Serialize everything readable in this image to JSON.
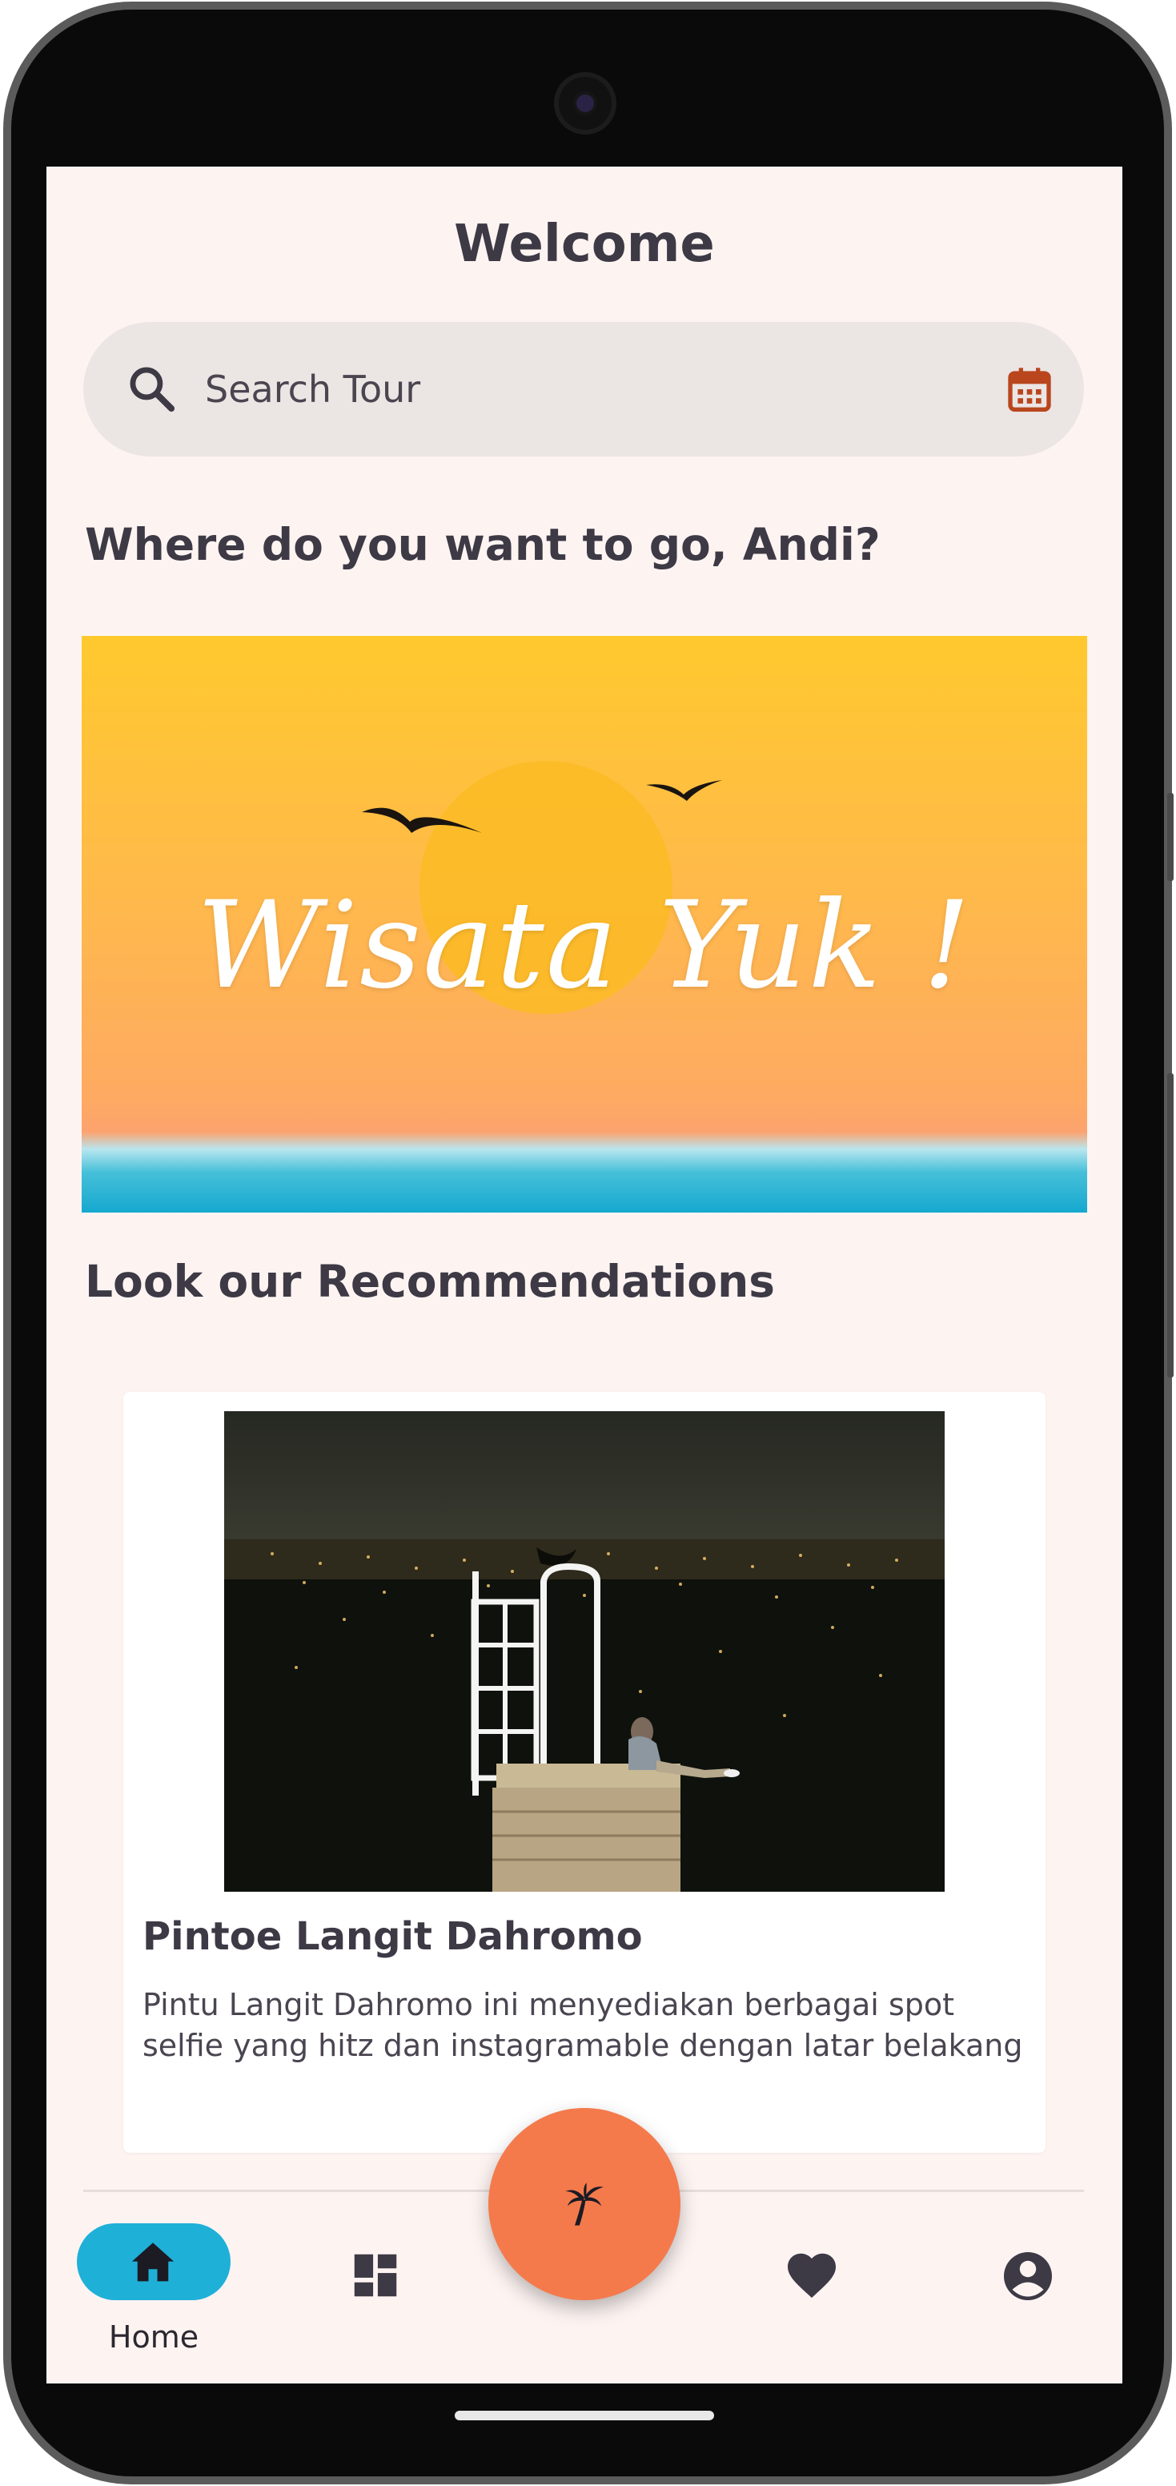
{
  "header": {
    "title": "Welcome"
  },
  "search": {
    "placeholder": "Search Tour",
    "icon": "search-icon",
    "calendar_icon": "calendar-icon"
  },
  "greeting": "Where do you want to go, Andi?",
  "banner": {
    "text": "Wisata Yuk !"
  },
  "recommendations": {
    "heading": "Look our Recommendations",
    "items": [
      {
        "title": "Pintoe Langit Dahromo",
        "description": "Pintu Langit Dahromo ini menyediakan berbagai spot selfie yang hitz dan instagramable dengan latar belakang"
      }
    ]
  },
  "bottom_nav": {
    "items": [
      {
        "label": "Home",
        "icon": "home-icon",
        "active": true
      },
      {
        "label": "",
        "icon": "dashboard-icon",
        "active": false
      },
      {
        "label": "",
        "icon": "palm-tree-icon",
        "active": false
      },
      {
        "label": "",
        "icon": "heart-icon",
        "active": false
      },
      {
        "label": "",
        "icon": "account-icon",
        "active": false
      }
    ]
  },
  "colors": {
    "background": "#fdf4f2",
    "text": "#3d3945",
    "accent_orange": "#f47a4c",
    "accent_blue": "#1fb0d8",
    "calendar_icon": "#b9461d"
  }
}
